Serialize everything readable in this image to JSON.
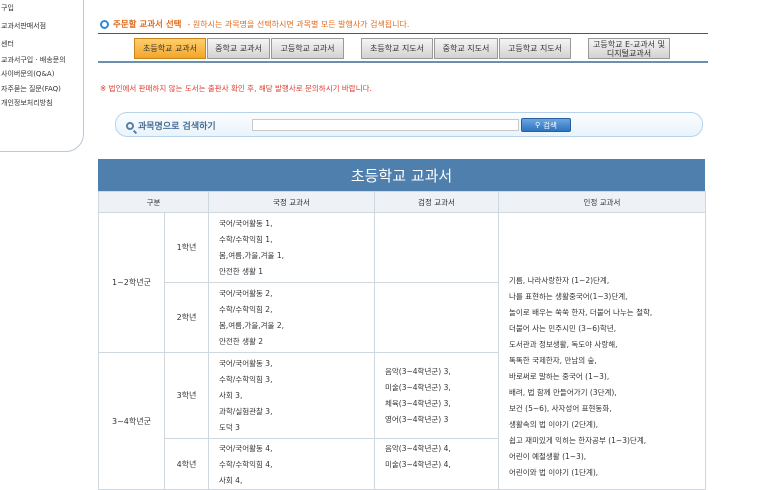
{
  "sidebar": {
    "items": [
      "구입",
      "교과서판매서점",
      "센터",
      "교과서구입 · 배송문의",
      "사이버문의(Q&A)",
      "자주묻는 질문(FAQ)",
      "개인정보처리방침"
    ]
  },
  "order": {
    "title": "주문할 교과서 선택",
    "description": "- 원하시는 과목명을 선택하시면 과목별 모든 발행사가 검색됩니다."
  },
  "tabs": [
    {
      "label": "초등학교 교과서",
      "active": true
    },
    {
      "label": "중학교 교과서",
      "active": false
    },
    {
      "label": "고등학교 교과서",
      "active": false
    },
    {
      "label": "초등학교 지도서",
      "active": false
    },
    {
      "label": "중학교 지도서",
      "active": false
    },
    {
      "label": "고등학교 지도서",
      "active": false
    },
    {
      "label": "고등학교 E-교과서 및 디지털교과서",
      "active": false
    }
  ],
  "notice": "※ 법인에서 판매하지 않는 도서는 출판사 확인 후, 해당 발행사로 문의하시기 바랍니다.",
  "search": {
    "label": "과목명으로 검색하기",
    "placeholder": "",
    "button": "검색"
  },
  "table": {
    "title": "초등학교 교과서",
    "headers": [
      "구분",
      "국정 교과서",
      "검정 교과서",
      "인정 교과서"
    ],
    "groups": [
      {
        "name": "1~2학년군",
        "grades": [
          {
            "grade": "1학년",
            "guk": [
              "국어/국어활동 1,",
              "수학/수학익힘 1,",
              "봄,여름,가을,겨울 1,",
              "안전한 생활 1"
            ],
            "geom": []
          },
          {
            "grade": "2학년",
            "guk": [
              "국어/국어활동 2,",
              "수학/수학익힘 2,",
              "봄,여름,가을,겨울 2,",
              "안전한 생활 2"
            ],
            "geom": []
          }
        ]
      },
      {
        "name": "3~4학년군",
        "grades": [
          {
            "grade": "3학년",
            "guk": [
              "국어/국어활동 3,",
              "수학/수학익힘 3,",
              "사회 3,",
              "과학/실험관찰 3,",
              "도덕 3"
            ],
            "geom": [
              "음악(3~4학년군) 3,",
              "미술(3~4학년군) 3,",
              "체육(3~4학년군) 3,",
              "영어(3~4학년군) 3"
            ]
          },
          {
            "grade": "4학년",
            "guk": [
              "국어/국어활동 4,",
              "수학/수학익힘 4,",
              "사회 4,"
            ],
            "geom": [
              "음악(3~4학년군) 4,",
              "미술(3~4학년군) 4,"
            ]
          }
        ]
      }
    ],
    "ingeong": [
      "기름,   나라사랑한자 (1~2)단계,",
      "나를 표현하는 생활중국어(1~3)단계,",
      "놀이로 배우는 쑥쑥 한자,   더불어 나누는 철학,",
      "더불어 사는 민주시민 (3~6)학년,",
      "도서관과 정보생활,   독도야 사랑해,",
      "똑똑한 국제한자,   만남의 숲,",
      "바로써로 말하는 중국어 (1~3),",
      "배려,   법 함께 만들어가기 (3단계),",
      "보건 (5~6),   사자성어 표현동화,",
      "생활속의 법 이야기 (2단계),",
      "쉽고 재미있게 익히는 한자공부 (1~3)단계,",
      "어린이 예절생활 (1~3),",
      "어린이와 법 이야기 (1단계),"
    ]
  }
}
